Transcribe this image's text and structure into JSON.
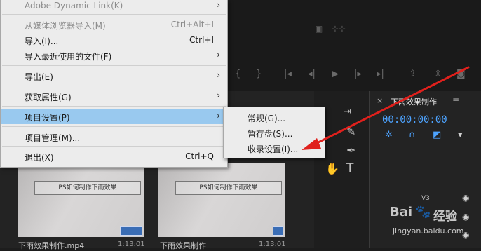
{
  "file_menu": {
    "items": [
      {
        "label": "Adobe Dynamic Link(K)",
        "shortcut": "",
        "submenu": true,
        "state": "dim"
      },
      {
        "label": "从媒体浏览器导入(M)",
        "shortcut": "Ctrl+Alt+I",
        "submenu": false,
        "state": "dim"
      },
      {
        "label": "导入(I)...",
        "shortcut": "Ctrl+I",
        "submenu": false,
        "state": "normal"
      },
      {
        "label": "导入最近使用的文件(F)",
        "shortcut": "",
        "submenu": true,
        "state": "normal"
      },
      {
        "label": "导出(E)",
        "shortcut": "",
        "submenu": true,
        "state": "normal"
      },
      {
        "label": "获取属性(G)",
        "shortcut": "",
        "submenu": true,
        "state": "normal"
      },
      {
        "label": "项目设置(P)",
        "shortcut": "",
        "submenu": true,
        "state": "highlighted"
      },
      {
        "label": "项目管理(M)...",
        "shortcut": "",
        "submenu": false,
        "state": "normal"
      },
      {
        "label": "退出(X)",
        "shortcut": "Ctrl+Q",
        "submenu": false,
        "state": "normal"
      }
    ],
    "submenu_arrow": "›"
  },
  "project_settings_submenu": {
    "items": [
      {
        "label": "常规(G)..."
      },
      {
        "label": "暂存盘(S)..."
      },
      {
        "label": "收录设置(I)..."
      }
    ]
  },
  "project_panel": {
    "clips": [
      {
        "thumb_title": "PS如何制作下雨效果",
        "name": "下雨效果制作.mp4",
        "duration": "1:13:01"
      },
      {
        "thumb_title": "PS如何制作下雨效果",
        "name": "下雨效果制作",
        "duration": "1:13:01"
      }
    ]
  },
  "timeline": {
    "close_glyph": "×",
    "title": "下雨效果制作",
    "menu_glyph": "≡",
    "timecode": "00:00:00:00",
    "track_label": "V3"
  },
  "icons": {
    "submenu_arrow": "chevron-right-icon",
    "tools": [
      "hand-icon",
      "type-icon",
      "pen-icon",
      "razor-icon",
      "track-select-icon"
    ],
    "timeline": [
      "snap-icon",
      "linked-selection-icon",
      "add-marker-icon",
      "eye-icon",
      "camera-icon"
    ]
  },
  "watermark": {
    "brand": "Bai",
    "paw": "🐾",
    "jingyan": "经验",
    "url": "jingyan.baidu.com"
  },
  "colors": {
    "menu_bg": "#ececec",
    "menu_highlight": "#99c9ef",
    "timecode": "#4da3ff",
    "annotation_arrow": "#e0201c"
  }
}
